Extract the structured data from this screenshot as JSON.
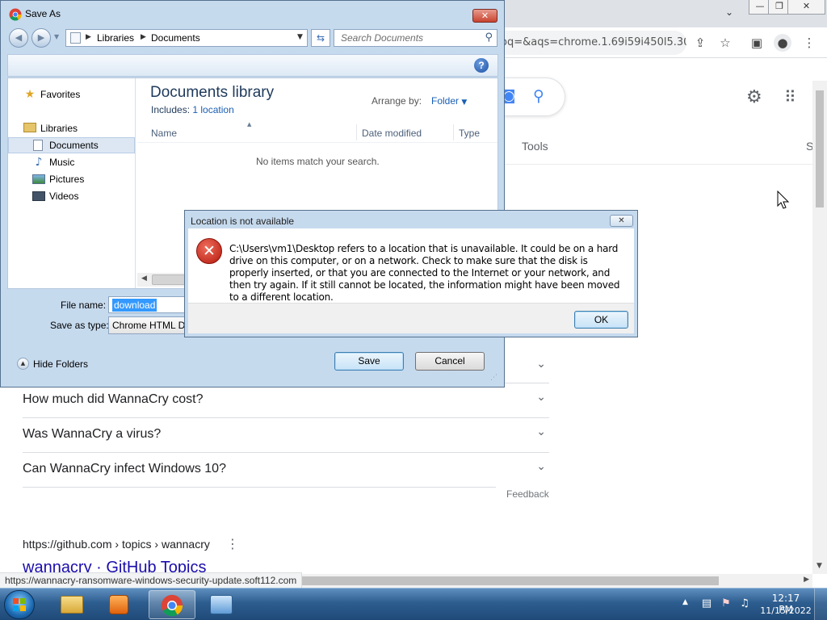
{
  "browser": {
    "omnibox_text": "oq=&aqs=chrome.1.69i59i450l5.30...",
    "window_controls": {
      "minimize": "—",
      "restore": "❐",
      "close": "✕"
    },
    "tools_label": "Tools",
    "partial_tab_label": "S",
    "paa_questions": [
      {
        "question": "How much did WannaCry cost?"
      },
      {
        "question": "Was WannaCry a virus?"
      },
      {
        "question": "Can WannaCry infect Windows 10?"
      }
    ],
    "feedback_label": "Feedback",
    "result": {
      "url": "https://github.com › topics › wannacry",
      "title": "wannacry · GitHub Topics"
    },
    "status_url": "https://wannacry-ransomware-windows-security-update.soft112.com",
    "icons": [
      "share-icon",
      "star-icon",
      "sidebar-icon",
      "profile-icon",
      "menu-icon",
      "camera-icon",
      "search-icon",
      "settings-icon",
      "apps-icon"
    ]
  },
  "save_as": {
    "title": "Save As",
    "address": {
      "segment1": "Libraries",
      "segment2": "Documents"
    },
    "search_placeholder": "Search Documents",
    "nav": {
      "favorites": "Favorites",
      "libraries": "Libraries",
      "documents": "Documents",
      "music": "Music",
      "pictures": "Pictures",
      "videos": "Videos"
    },
    "library_title": "Documents library",
    "includes_label": "Includes:",
    "includes_link": "1 location",
    "arrange_label": "Arrange by:",
    "arrange_value": "Folder",
    "columns": {
      "name": "Name",
      "date_modified": "Date modified",
      "type": "Type"
    },
    "empty_message": "No items match your search.",
    "file_name_label": "File name:",
    "file_name_value": "download",
    "save_type_label": "Save as type:",
    "save_type_value": "Chrome HTML Document",
    "hide_folders_label": "Hide Folders",
    "save_button": "Save",
    "cancel_button": "Cancel"
  },
  "error_dialog": {
    "title": "Location is not available",
    "message": "C:\\Users\\vm1\\Desktop refers to a location that is unavailable. It could be on a hard drive on this computer, or on a network. Check to make sure that the disk is properly inserted, or that you are connected to the Internet or your network, and then try again. If it still cannot be located, the information might have been moved to a different location.",
    "ok_button": "OK"
  },
  "taskbar": {
    "apps": [
      "windows-explorer",
      "media-player",
      "chrome",
      "control-panel"
    ],
    "active_app": "chrome",
    "clock_time": "12:17 PM",
    "clock_date": "11/15/2022"
  }
}
